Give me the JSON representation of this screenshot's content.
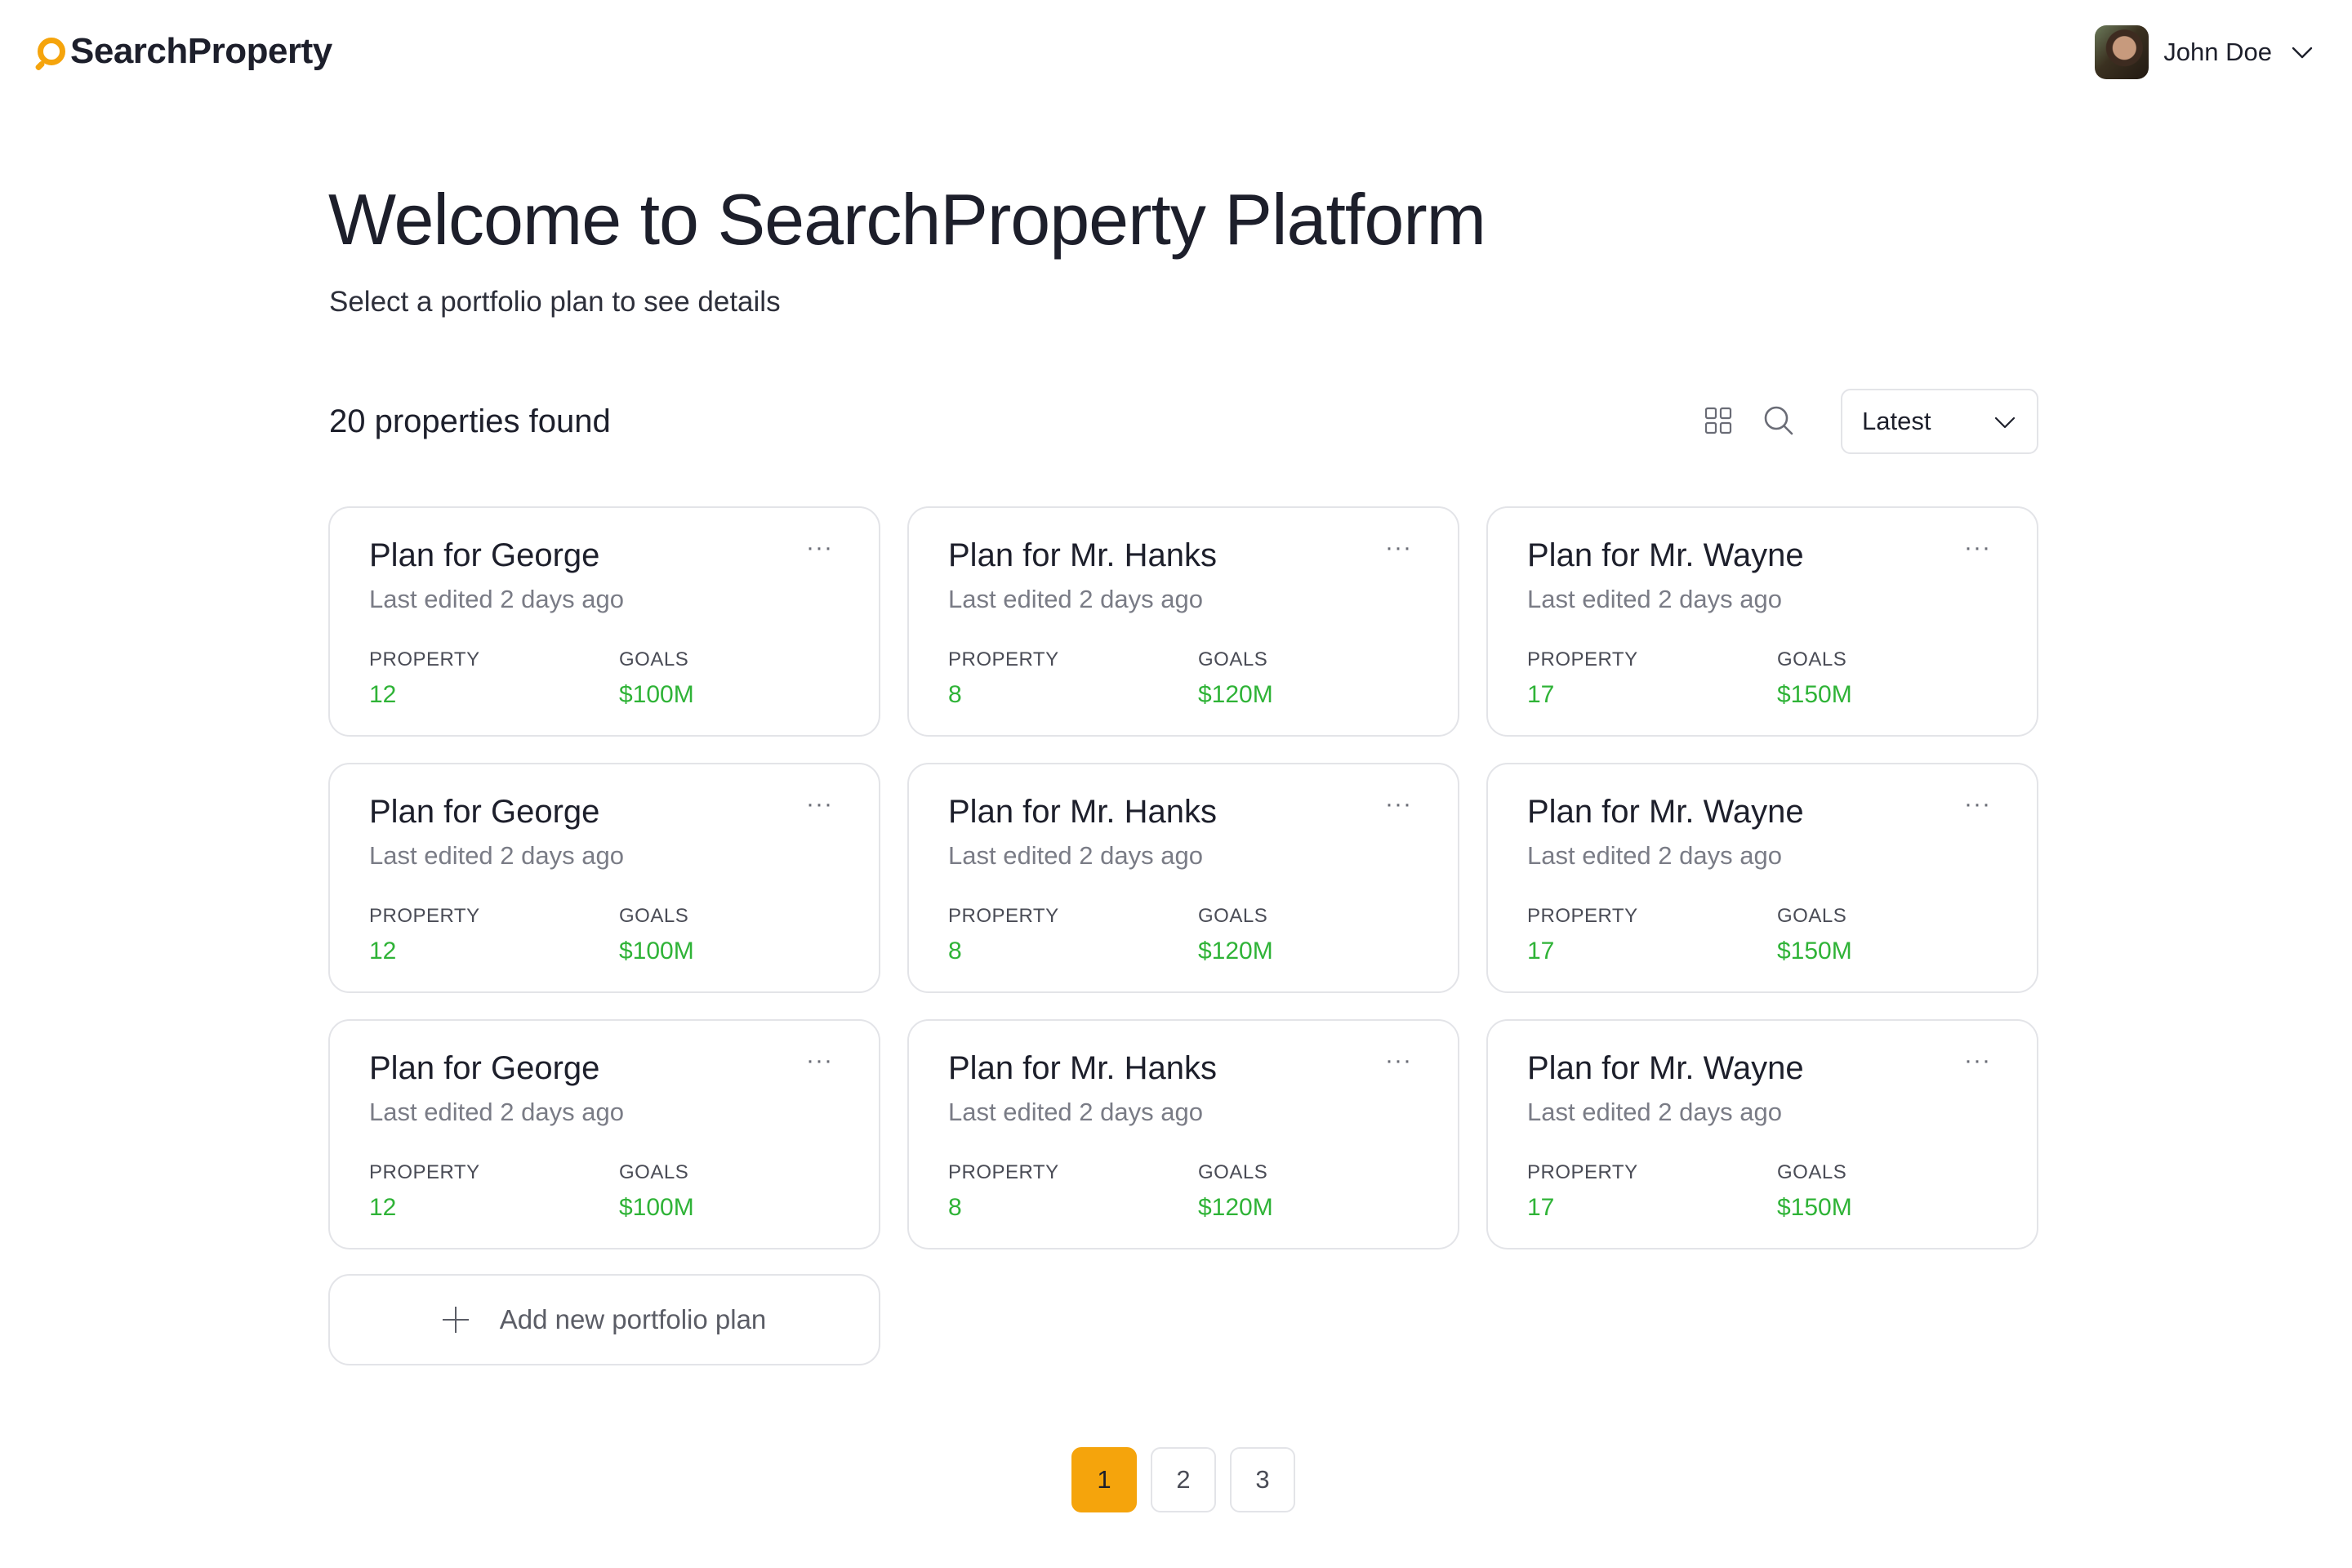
{
  "brand": {
    "name": "SearchProperty",
    "accent": "#f5a40c"
  },
  "user": {
    "name": "John Doe",
    "icon": "chevron-down-icon"
  },
  "hero": {
    "title": "Welcome to SearchProperty Platform",
    "subtitle": "Select a portfolio plan to see details"
  },
  "toolbar": {
    "count_label": "20 properties found",
    "sort_value": "Latest",
    "view_icon": "grid-view-icon",
    "search_icon": "search-icon"
  },
  "cards": [
    {
      "title": "Plan for George",
      "edited": "Last edited 2 days ago",
      "property_label": "PROPERTY",
      "property": "12",
      "goals_label": "GOALS",
      "goals": "$100M"
    },
    {
      "title": "Plan for Mr. Hanks",
      "edited": "Last edited 2 days ago",
      "property_label": "PROPERTY",
      "property": "8",
      "goals_label": "GOALS",
      "goals": "$120M"
    },
    {
      "title": "Plan for Mr. Wayne",
      "edited": "Last edited 2 days ago",
      "property_label": "PROPERTY",
      "property": "17",
      "goals_label": "GOALS",
      "goals": "$150M"
    },
    {
      "title": "Plan for George",
      "edited": "Last edited 2 days ago",
      "property_label": "PROPERTY",
      "property": "12",
      "goals_label": "GOALS",
      "goals": "$100M"
    },
    {
      "title": "Plan for Mr. Hanks",
      "edited": "Last edited 2 days ago",
      "property_label": "PROPERTY",
      "property": "8",
      "goals_label": "GOALS",
      "goals": "$120M"
    },
    {
      "title": "Plan for Mr. Wayne",
      "edited": "Last edited 2 days ago",
      "property_label": "PROPERTY",
      "property": "17",
      "goals_label": "GOALS",
      "goals": "$150M"
    },
    {
      "title": "Plan for George",
      "edited": "Last edited 2 days ago",
      "property_label": "PROPERTY",
      "property": "12",
      "goals_label": "GOALS",
      "goals": "$100M"
    },
    {
      "title": "Plan for Mr. Hanks",
      "edited": "Last edited 2 days ago",
      "property_label": "PROPERTY",
      "property": "8",
      "goals_label": "GOALS",
      "goals": "$120M"
    },
    {
      "title": "Plan for Mr. Wayne",
      "edited": "Last edited 2 days ago",
      "property_label": "PROPERTY",
      "property": "17",
      "goals_label": "GOALS",
      "goals": "$150M"
    }
  ],
  "card_menu": "···",
  "add_plan_label": "Add new portfolio plan",
  "pagination": {
    "pages": [
      "1",
      "2",
      "3"
    ],
    "active": "1"
  },
  "colors": {
    "value_green": "#2fb337",
    "border": "#e3e4e8",
    "text": "#1d1f2b"
  }
}
